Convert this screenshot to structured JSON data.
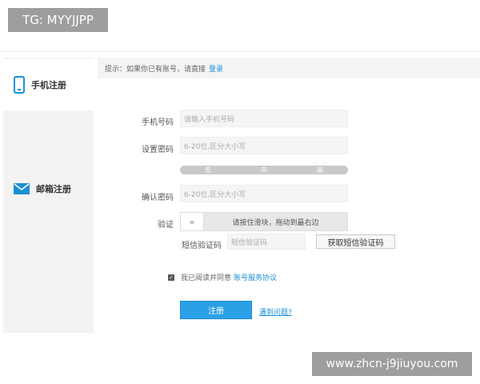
{
  "overlay": {
    "top_label": "TG: MYYJJPP",
    "bottom_label": "www.zhcn-j9jiuyou.com"
  },
  "sidebar": {
    "items": [
      {
        "label": "手机注册",
        "icon": "phone-icon",
        "active": true
      },
      {
        "label": "邮箱注册",
        "icon": "mail-icon",
        "active": false
      }
    ]
  },
  "notice": {
    "text": "提示：如果你已有账号，请直接",
    "link": "登录"
  },
  "form": {
    "phone_label": "手机号码",
    "phone_placeholder": "请输入手机号码",
    "password_label": "设置密码",
    "password_placeholder": "6-20位,区分大小写",
    "strength": [
      "低",
      "中",
      "高"
    ],
    "confirm_label": "确认密码",
    "confirm_placeholder": "6-20位,区分大小写",
    "verify_label": "验证",
    "slider_handle": "»",
    "slider_text": "请按住滑块，拖动到最右边",
    "sms_label": "短信验证码",
    "sms_placeholder": "短信验证码",
    "sms_button": "获取短信验证码",
    "agree_text": "我已阅读并同意",
    "agree_link": "账号服务协议",
    "register_button": "注册",
    "trouble_link": "遇到问题?"
  },
  "colors": {
    "accent": "#1a8fd6",
    "button": "#2ba0e6"
  }
}
